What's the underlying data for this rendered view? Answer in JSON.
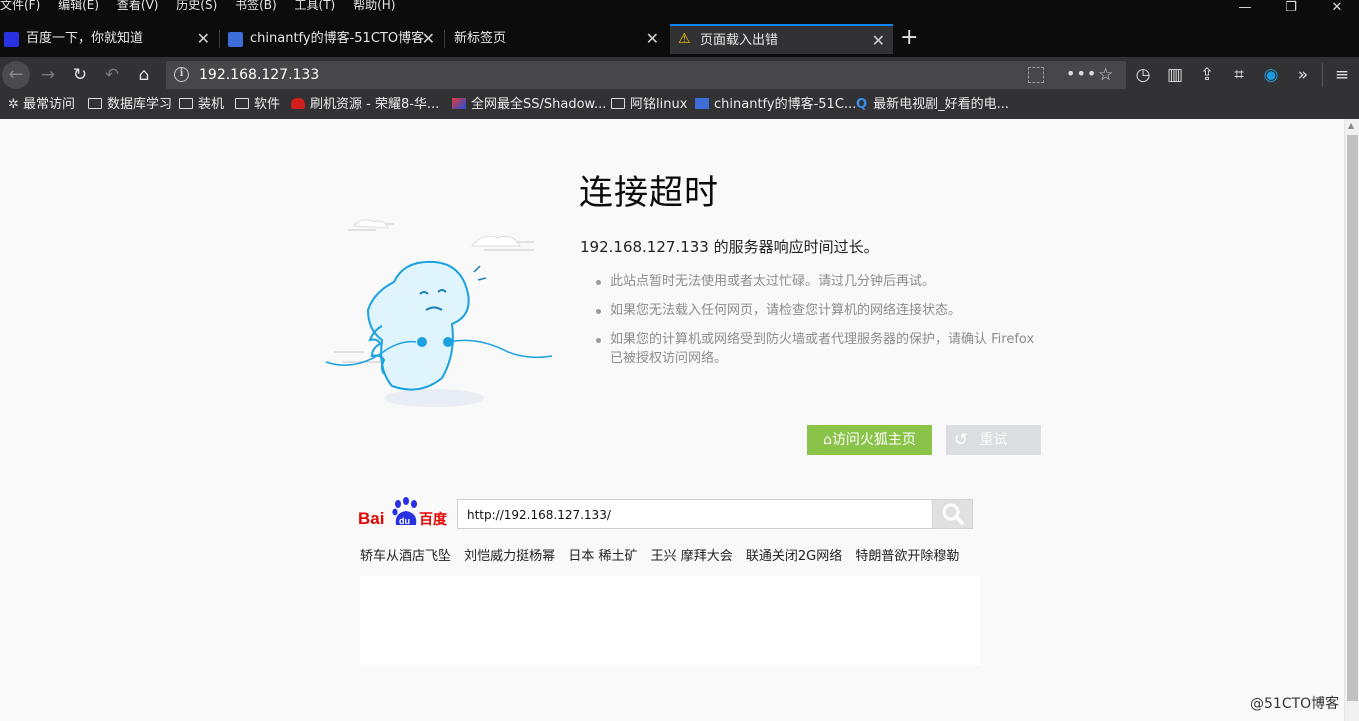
{
  "menu": [
    "文件(F)",
    "编辑(E)",
    "查看(V)",
    "历史(S)",
    "书签(B)",
    "工具(T)",
    "帮助(H)"
  ],
  "window": {
    "minimize": "—",
    "maximize": "❐",
    "close": "✕"
  },
  "tabs": [
    {
      "label": "百度一下，你就知道",
      "close": "✕"
    },
    {
      "label": "chinantfy的博客-51CTO博客",
      "close": "✕"
    },
    {
      "label": "新标签页",
      "close": "✕"
    },
    {
      "label": "页面载入出错",
      "close": "✕"
    }
  ],
  "new_tab": "+",
  "address": {
    "url": "192.168.127.133"
  },
  "bookmarks": [
    "最常访问",
    "数据库学习",
    "装机",
    "软件",
    "刷机资源 - 荣耀8-华...",
    "全网最全SS/Shadow...",
    "阿铭linux",
    "chinantfy的博客-51C...",
    "最新电视剧_好看的电..."
  ],
  "error": {
    "title": "连接超时",
    "description": "192.168.127.133 的服务器响应时间过长。",
    "reasons": [
      "此站点暂时无法使用或者太过忙碌。请过几分钟后再试。",
      "如果您无法载入任何网页，请检查您计算机的网络连接状态。",
      "如果您的计算机或网络受到防火墙或者代理服务器的保护，请确认 Firefox 已被授权访问网络。"
    ],
    "home_button": "访问火狐主页",
    "retry_button": "重试"
  },
  "baidu": {
    "logo_text_left": "Bai",
    "logo_text_right": "百度",
    "logo_paw_text": "du",
    "search_value": "http://192.168.127.133/",
    "hot_words": [
      "轿车从酒店飞坠",
      "刘恺威力挺杨幂",
      "日本 稀土矿",
      "王兴 摩拜大会",
      "联通关闭2G网络",
      "特朗普欲开除穆勒"
    ]
  },
  "watermark": "@51CTO博客",
  "colors": {
    "accent": "#0a84ff",
    "home_button": "#8bc34a",
    "baidu_red": "#e10601",
    "baidu_blue": "#2932e1"
  }
}
